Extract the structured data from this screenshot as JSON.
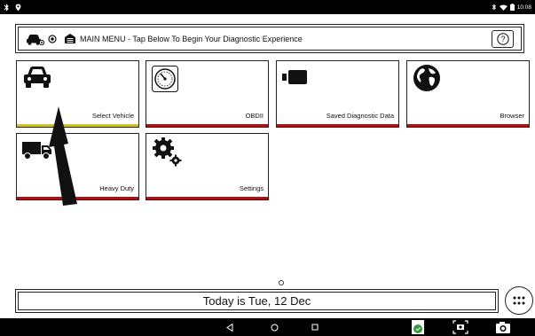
{
  "status_bar": {
    "time": "10:08",
    "left_icons": [
      "bluetooth-icon",
      "location-icon"
    ],
    "right_icons": [
      "bluetooth-icon",
      "wifi-icon",
      "battery-icon"
    ]
  },
  "header": {
    "title": "MAIN MENU - Tap Below To Begin Your Diagnostic Experience",
    "help_label": "?"
  },
  "tiles": [
    {
      "label": "Select Vehicle",
      "icon": "car-icon",
      "bar_color": "#c9c235"
    },
    {
      "label": "OBDII",
      "icon": "gauge-icon",
      "bar_color": "#a31616"
    },
    {
      "label": "Saved Diagnostic Data",
      "icon": "video-camera-icon",
      "bar_color": "#a31616"
    },
    {
      "label": "Browser",
      "icon": "globe-icon",
      "bar_color": "#a31616"
    },
    {
      "label": "Heavy Duty",
      "icon": "truck-icon",
      "bar_color": "#a31616"
    },
    {
      "label": "Settings",
      "icon": "gears-icon",
      "bar_color": "#a31616"
    }
  ],
  "footer": {
    "date_text": "Today is Tue, 12 Dec"
  },
  "colors": {
    "accent_yellow": "#c9c235",
    "accent_red": "#a31616",
    "bar_black": "#000000"
  }
}
